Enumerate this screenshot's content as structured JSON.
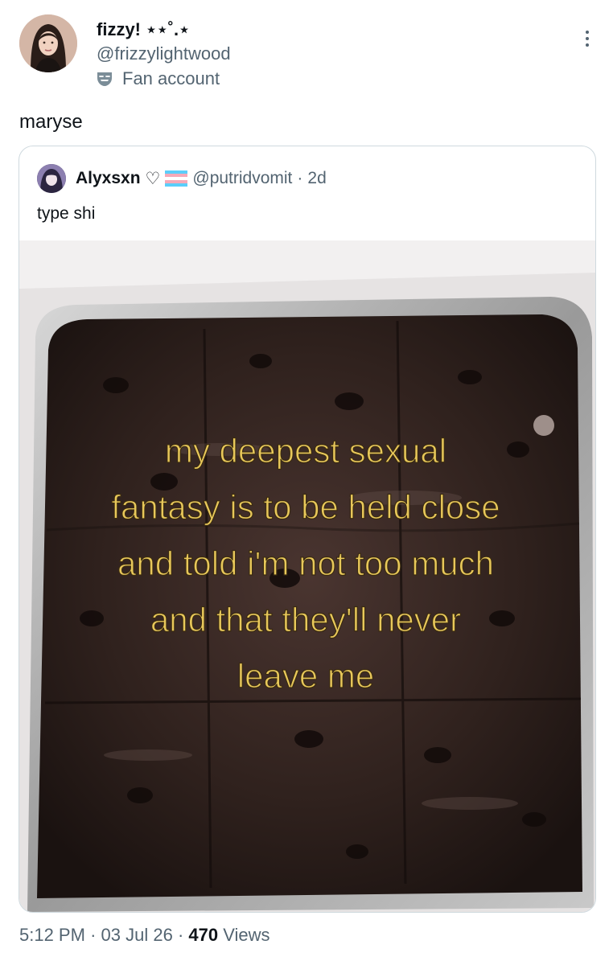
{
  "author": {
    "name": "fizzy! ⋆⋆˚.⋆",
    "handle": "@frizzylightwood",
    "badge": "Fan account",
    "avatar_icon": "profile-photo"
  },
  "tweet": {
    "text": "maryse"
  },
  "quoted": {
    "name": "Alyxsxn",
    "heart": "♡",
    "handle": "@putridvomit",
    "separator": "·",
    "time": "2d",
    "text": "type shi",
    "image": {
      "caption_lines": [
        "my deepest sexual",
        "fantasy is to be held close",
        "and told i'm not too much",
        "and that they'll never",
        "leave me"
      ],
      "caption_color": "#e8c85a"
    }
  },
  "meta": {
    "time": "5:12 PM",
    "sep": "·",
    "date": "03 Jul 26",
    "views_count": "470",
    "views_label": "Views"
  },
  "colors": {
    "text": "#0f1419",
    "secondary": "#536471",
    "border": "#cfd9de"
  }
}
